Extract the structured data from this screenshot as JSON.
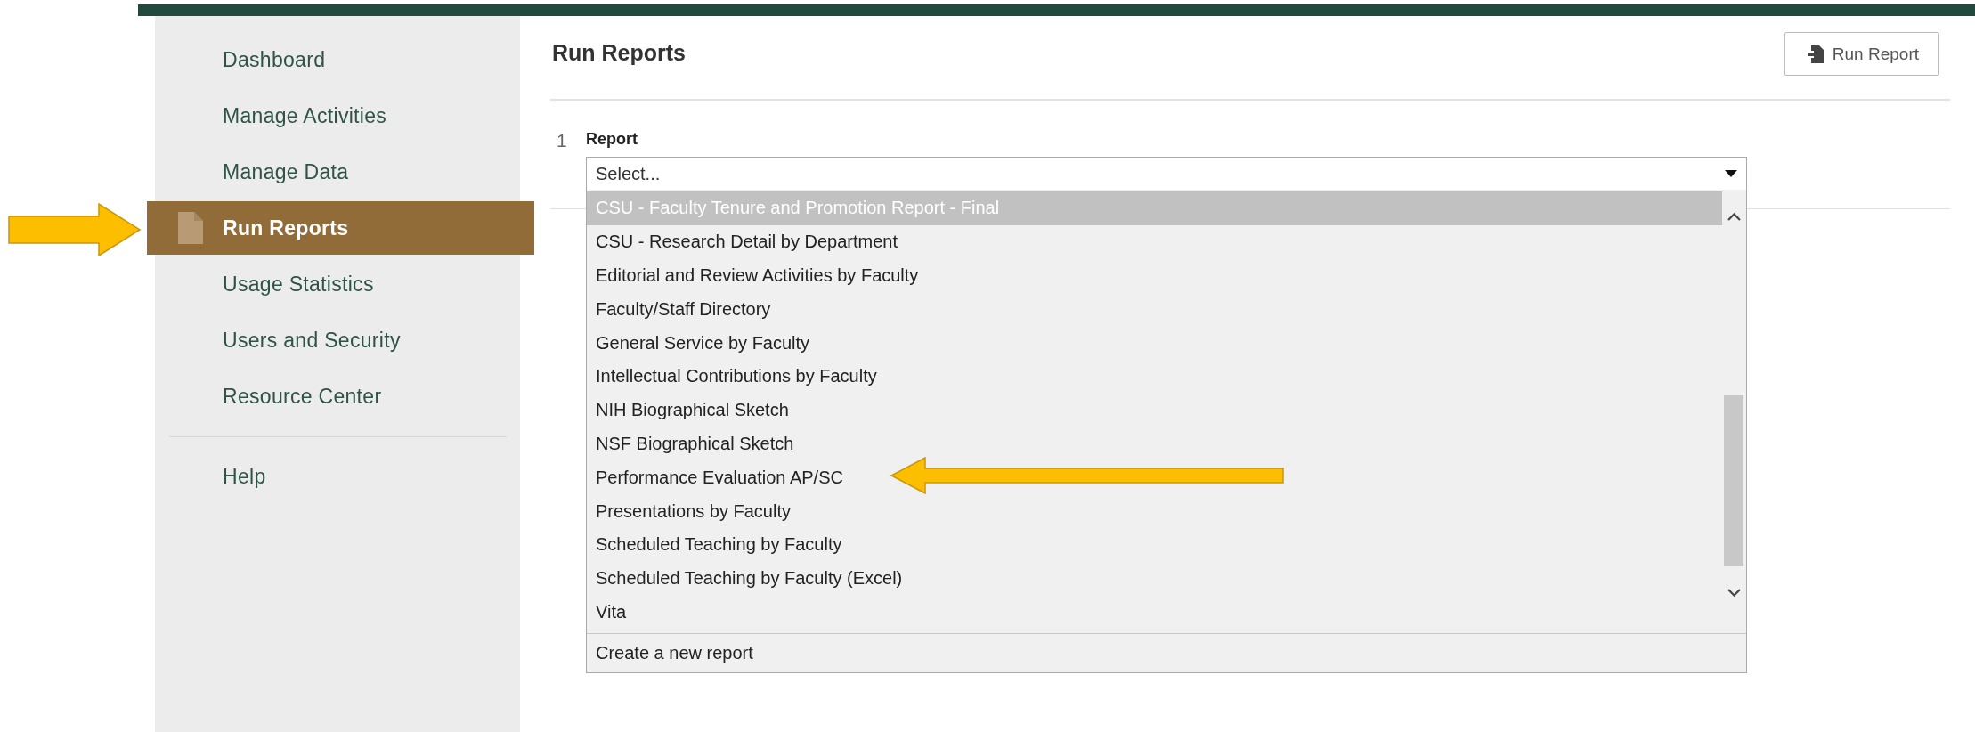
{
  "sidebar": {
    "items": [
      {
        "label": "Dashboard",
        "selected": false
      },
      {
        "label": "Manage Activities",
        "selected": false
      },
      {
        "label": "Manage Data",
        "selected": false
      },
      {
        "label": "Run Reports",
        "selected": true
      },
      {
        "label": "Usage Statistics",
        "selected": false
      },
      {
        "label": "Users and Security",
        "selected": false
      },
      {
        "label": "Resource Center",
        "selected": false
      }
    ],
    "footer_items": [
      {
        "label": "Help",
        "selected": false
      }
    ]
  },
  "page": {
    "title": "Run Reports",
    "run_button": "Run Report"
  },
  "report_field": {
    "number": "1",
    "label": "Report",
    "value": "Select...",
    "options": [
      {
        "label": "CSU - Faculty Tenure and Promotion Report - Final",
        "selected": true
      },
      {
        "label": "CSU - Research Detail by Department",
        "selected": false
      },
      {
        "label": "Editorial and Review Activities by Faculty",
        "selected": false
      },
      {
        "label": "Faculty/Staff Directory",
        "selected": false
      },
      {
        "label": "General Service by Faculty",
        "selected": false
      },
      {
        "label": "Intellectual Contributions by Faculty",
        "selected": false
      },
      {
        "label": "NIH Biographical Sketch",
        "selected": false
      },
      {
        "label": "NSF Biographical Sketch",
        "selected": false
      },
      {
        "label": "Performance Evaluation AP/SC",
        "selected": false
      },
      {
        "label": "Presentations by Faculty",
        "selected": false
      },
      {
        "label": "Scheduled Teaching by Faculty",
        "selected": false
      },
      {
        "label": "Scheduled Teaching by Faculty (Excel)",
        "selected": false
      },
      {
        "label": "Vita",
        "selected": false
      }
    ],
    "footer_option": "Create a new report"
  }
}
